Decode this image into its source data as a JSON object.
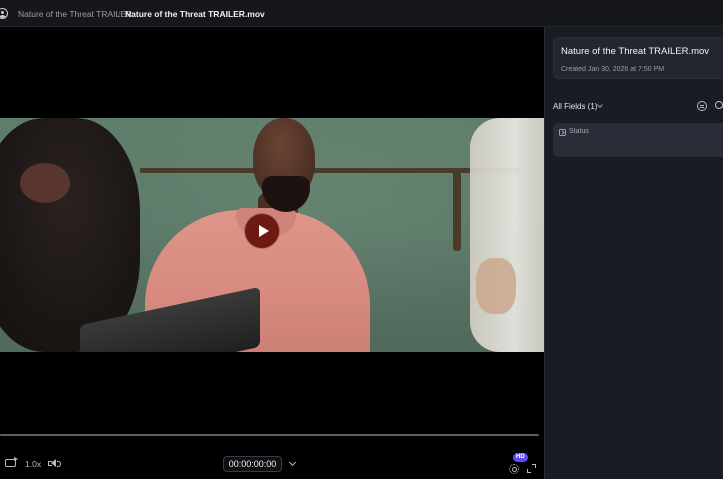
{
  "breadcrumb": {
    "parent": "Nature of the Threat TRAILER",
    "separator": "/",
    "current": "Nature of the Threat TRAILER.mov"
  },
  "player": {
    "speed": "1.0x",
    "timecode": "00:00:00:00",
    "quality_badge": "HD",
    "progress": 0,
    "icons": [
      "avatar-icon",
      "play-icon",
      "loop-icon",
      "volume-icon",
      "chevron-down-icon",
      "settings-icon",
      "fullscreen-icon"
    ]
  },
  "panel": {
    "asset_title": "Nature of the Threat TRAILER.mov",
    "created": "Created Jan 30, 2026 at 7:50 PM",
    "fields_label": "All Fields (1)",
    "fields": [
      {
        "label": "Status",
        "icon": "status-icon"
      }
    ],
    "icons": [
      "filter-icon",
      "search-icon"
    ]
  },
  "colors": {
    "play_button": "#6c1a12",
    "hd_badge": "#5f4ff2",
    "panel_bg": "#1a1c23"
  }
}
